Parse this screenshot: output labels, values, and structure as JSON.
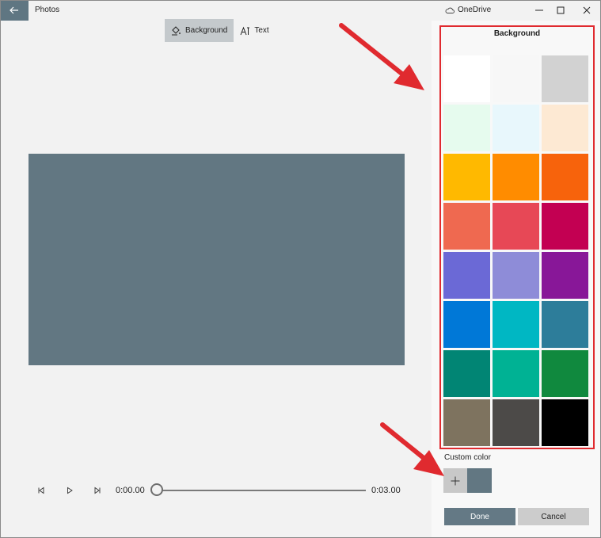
{
  "titlebar": {
    "app_title": "Photos",
    "onedrive_label": "OneDrive",
    "accent": "#5f7682"
  },
  "toolbar": {
    "background_label": "Background",
    "text_label": "Text"
  },
  "preview": {
    "color": "#627782"
  },
  "playback": {
    "current_time": "0:00.00",
    "end_time": "0:03.00",
    "progress": 0
  },
  "panel": {
    "title": "Background",
    "swatches": [
      "#ffffff",
      "#f7f7f7",
      "#d2d2d2",
      "#e6fbee",
      "#e8f7fc",
      "#fde9d3",
      "#ffb900",
      "#ff8c00",
      "#f7630c",
      "#ef6950",
      "#e74856",
      "#c30052",
      "#6b69d6",
      "#8e8cd8",
      "#881798",
      "#0078d7",
      "#00b7c3",
      "#2d7d9a",
      "#018574",
      "#00b294",
      "#10893e",
      "#7e735f",
      "#4c4a48",
      "#000000"
    ],
    "custom_color_label": "Custom color",
    "custom_add_symbol": "+",
    "custom_color": "#627782",
    "done_label": "Done",
    "cancel_label": "Cancel",
    "highlight_color": "#e02a2f"
  }
}
